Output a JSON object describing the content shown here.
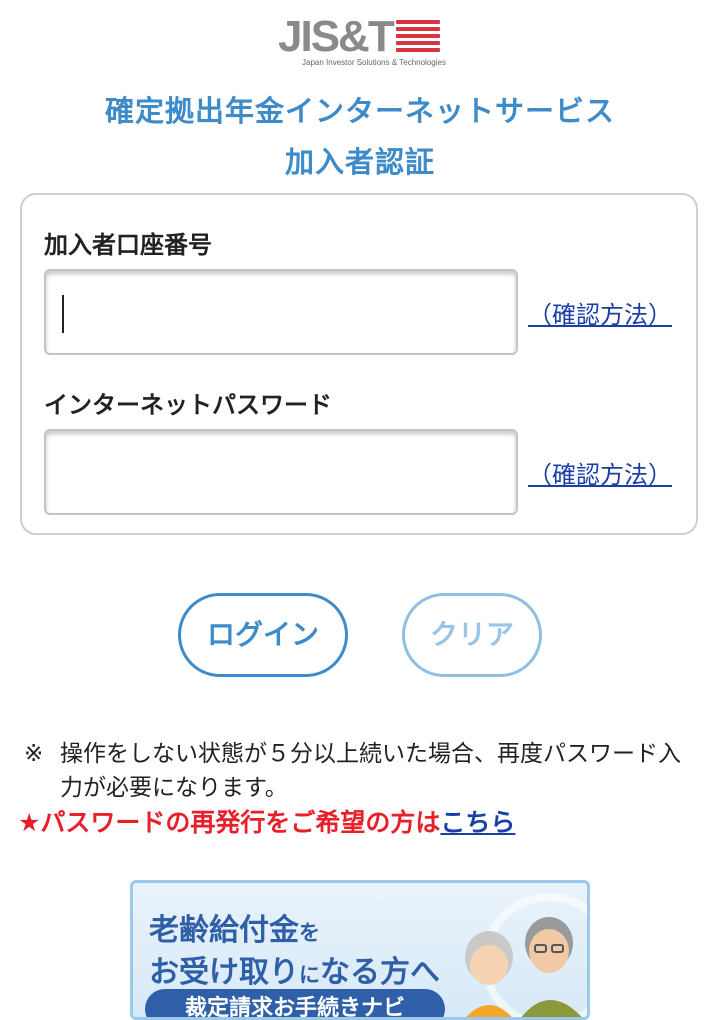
{
  "logo": {
    "main": "JIS&T",
    "sub": "Japan Investor Solutions & Technologies"
  },
  "header": {
    "title": "確定拠出年金インターネットサービス",
    "subtitle": "加入者認証"
  },
  "form": {
    "account_label": "加入者口座番号",
    "account_value": "",
    "password_label": "インターネットパスワード",
    "password_value": "",
    "confirm_link": "（確認方法）"
  },
  "buttons": {
    "login": "ログイン",
    "clear": "クリア"
  },
  "notice": {
    "mark": "※",
    "text": "操作をしない状態が５分以上続いた場合、再度パスワード入力が必要になります。"
  },
  "reissue": {
    "text": "★パスワードの再発行をご希望の方は",
    "link": "こちら"
  },
  "banner": {
    "line1_big": "老齢給付金",
    "line1_small": "を",
    "line2_a": "お受け取り",
    "line2_small": "に",
    "line2_b": "なる方へ",
    "pill": "裁定請求お手続きナビ"
  },
  "colors": {
    "accent": "#3d8bc9",
    "link": "#1a3fa8",
    "alert": "#e8202a",
    "logo_red": "#d9343f"
  }
}
